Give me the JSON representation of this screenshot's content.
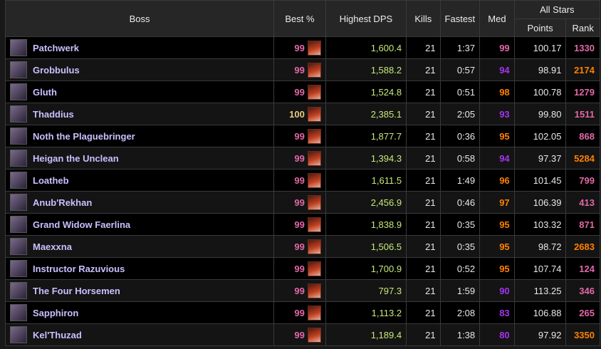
{
  "headers": {
    "boss": "Boss",
    "best": "Best %",
    "dps": "Highest DPS",
    "kills": "Kills",
    "fastest": "Fastest",
    "med": "Med",
    "allstars": "All Stars",
    "points": "Points",
    "rank": "Rank"
  },
  "colors": {
    "pink": "#e268a8",
    "orange": "#ff8000",
    "purple": "#a335ee",
    "legendary_gold": "#e5cc80",
    "dps_green": "#c6ea7a",
    "boss_name": "#c8c0ff"
  },
  "rows": [
    {
      "boss": "Patchwerk",
      "icon": "patchwerk-portrait-icon",
      "best": "99",
      "best_color": "#e268a8",
      "dps": "1,600.4",
      "kills": "21",
      "fastest": "1:37",
      "med": "99",
      "med_color": "#e268a8",
      "points": "100.17",
      "rank": "1330",
      "rank_color": "#e268a8"
    },
    {
      "boss": "Grobbulus",
      "icon": "grobbulus-portrait-icon",
      "best": "99",
      "best_color": "#e268a8",
      "dps": "1,588.2",
      "kills": "21",
      "fastest": "0:57",
      "med": "94",
      "med_color": "#a335ee",
      "points": "98.91",
      "rank": "2174",
      "rank_color": "#ff8000"
    },
    {
      "boss": "Gluth",
      "icon": "gluth-portrait-icon",
      "best": "99",
      "best_color": "#e268a8",
      "dps": "1,524.8",
      "kills": "21",
      "fastest": "0:51",
      "med": "98",
      "med_color": "#ff8000",
      "points": "100.78",
      "rank": "1279",
      "rank_color": "#e268a8"
    },
    {
      "boss": "Thaddius",
      "icon": "thaddius-portrait-icon",
      "best": "100",
      "best_color": "#e5cc80",
      "dps": "2,385.1",
      "kills": "21",
      "fastest": "2:05",
      "med": "93",
      "med_color": "#a335ee",
      "points": "99.80",
      "rank": "1511",
      "rank_color": "#e268a8"
    },
    {
      "boss": "Noth the Plaguebringer",
      "icon": "noth-portrait-icon",
      "best": "99",
      "best_color": "#e268a8",
      "dps": "1,877.7",
      "kills": "21",
      "fastest": "0:36",
      "med": "95",
      "med_color": "#ff8000",
      "points": "102.05",
      "rank": "868",
      "rank_color": "#e268a8"
    },
    {
      "boss": "Heigan the Unclean",
      "icon": "heigan-portrait-icon",
      "best": "99",
      "best_color": "#e268a8",
      "dps": "1,394.3",
      "kills": "21",
      "fastest": "0:58",
      "med": "94",
      "med_color": "#a335ee",
      "points": "97.37",
      "rank": "5284",
      "rank_color": "#ff8000"
    },
    {
      "boss": "Loatheb",
      "icon": "loatheb-portrait-icon",
      "best": "99",
      "best_color": "#e268a8",
      "dps": "1,611.5",
      "kills": "21",
      "fastest": "1:49",
      "med": "96",
      "med_color": "#ff8000",
      "points": "101.45",
      "rank": "799",
      "rank_color": "#e268a8"
    },
    {
      "boss": "Anub'Rekhan",
      "icon": "anubrekhan-portrait-icon",
      "best": "99",
      "best_color": "#e268a8",
      "dps": "2,456.9",
      "kills": "21",
      "fastest": "0:46",
      "med": "97",
      "med_color": "#ff8000",
      "points": "106.39",
      "rank": "413",
      "rank_color": "#e268a8"
    },
    {
      "boss": "Grand Widow Faerlina",
      "icon": "faerlina-portrait-icon",
      "best": "99",
      "best_color": "#e268a8",
      "dps": "1,838.9",
      "kills": "21",
      "fastest": "0:35",
      "med": "95",
      "med_color": "#ff8000",
      "points": "103.32",
      "rank": "871",
      "rank_color": "#e268a8"
    },
    {
      "boss": "Maexxna",
      "icon": "maexxna-portrait-icon",
      "best": "99",
      "best_color": "#e268a8",
      "dps": "1,506.5",
      "kills": "21",
      "fastest": "0:35",
      "med": "95",
      "med_color": "#ff8000",
      "points": "98.72",
      "rank": "2683",
      "rank_color": "#ff8000"
    },
    {
      "boss": "Instructor Razuvious",
      "icon": "razuvious-portrait-icon",
      "best": "99",
      "best_color": "#e268a8",
      "dps": "1,700.9",
      "kills": "21",
      "fastest": "0:52",
      "med": "95",
      "med_color": "#ff8000",
      "points": "107.74",
      "rank": "124",
      "rank_color": "#e268a8"
    },
    {
      "boss": "The Four Horsemen",
      "icon": "four-horsemen-portrait-icon",
      "best": "99",
      "best_color": "#e268a8",
      "dps": "797.3",
      "kills": "21",
      "fastest": "1:59",
      "med": "90",
      "med_color": "#a335ee",
      "points": "113.25",
      "rank": "346",
      "rank_color": "#e268a8"
    },
    {
      "boss": "Sapphiron",
      "icon": "sapphiron-portrait-icon",
      "best": "99",
      "best_color": "#e268a8",
      "dps": "1,113.2",
      "kills": "21",
      "fastest": "2:08",
      "med": "83",
      "med_color": "#a335ee",
      "points": "106.88",
      "rank": "265",
      "rank_color": "#e268a8"
    },
    {
      "boss": "Kel'Thuzad",
      "icon": "kelthuzad-portrait-icon",
      "best": "99",
      "best_color": "#e268a8",
      "dps": "1,189.4",
      "kills": "21",
      "fastest": "1:38",
      "med": "80",
      "med_color": "#a335ee",
      "points": "97.92",
      "rank": "3350",
      "rank_color": "#ff8000"
    }
  ]
}
